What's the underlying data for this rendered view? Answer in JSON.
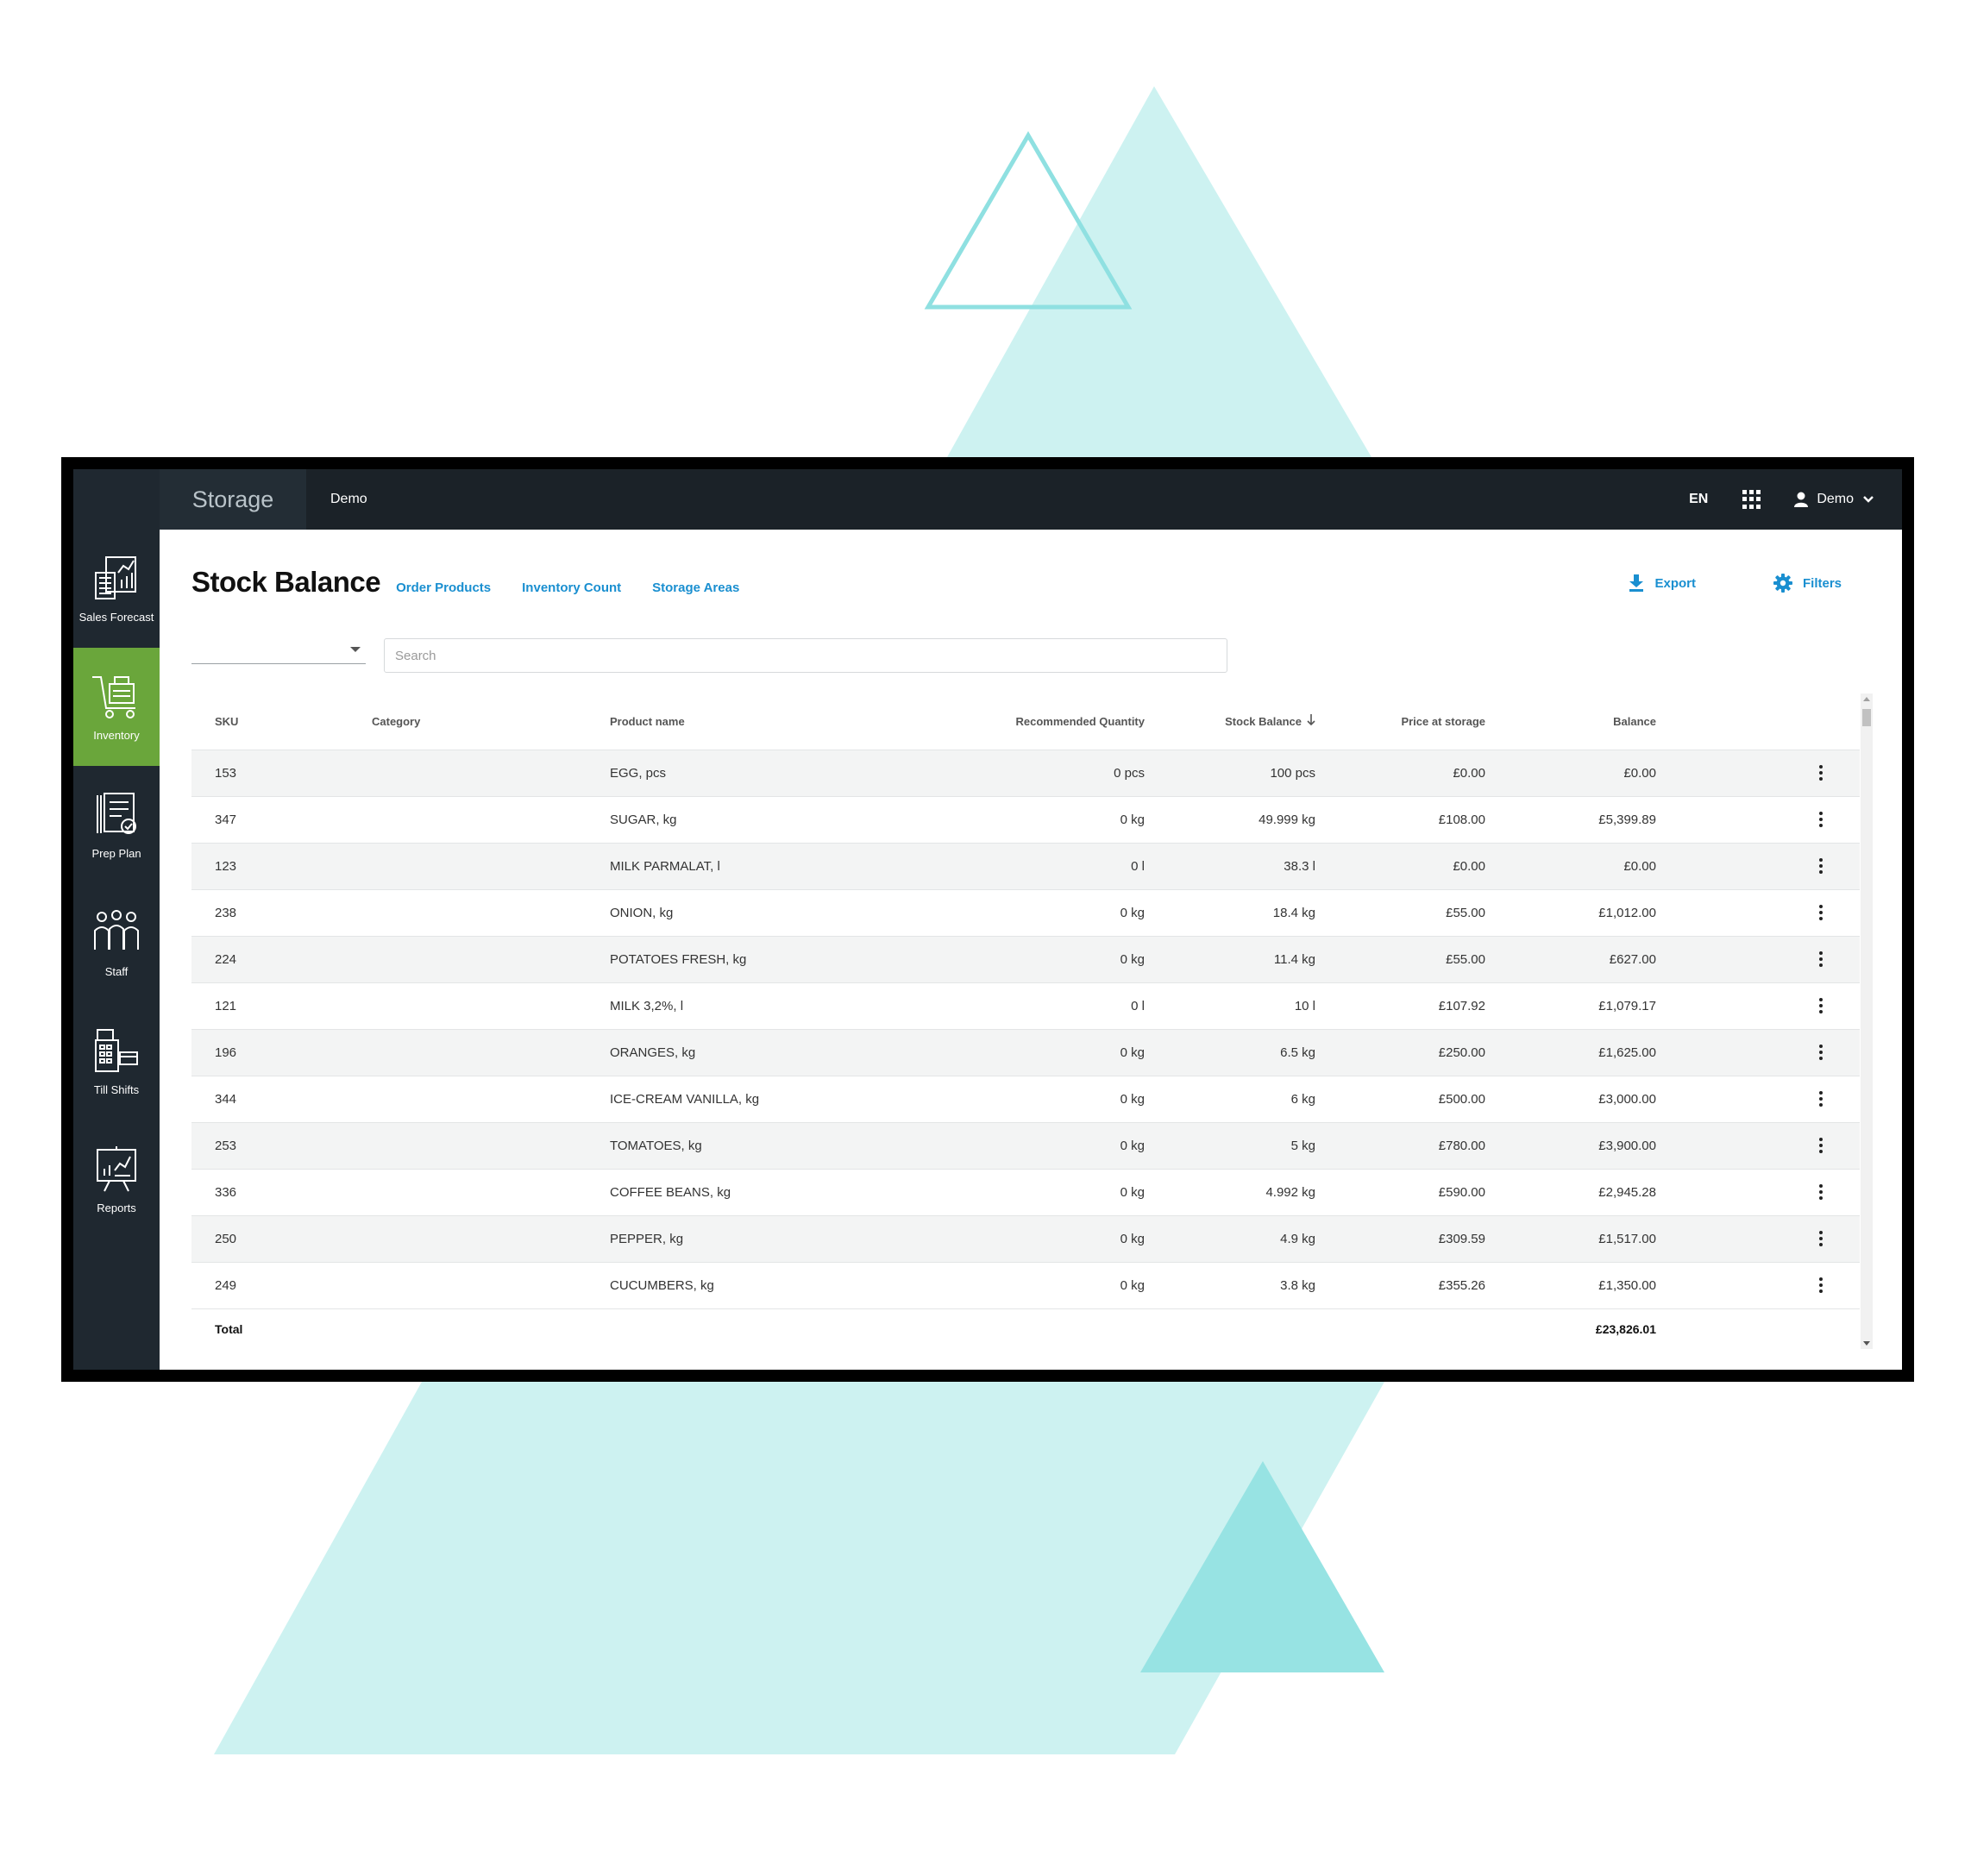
{
  "header": {
    "app_title": "Storage",
    "venue": "Demo",
    "language": "EN",
    "user": "Demo"
  },
  "sidebar": {
    "items": [
      {
        "label": "Sales Forecast",
        "icon": "sales-forecast-icon",
        "active": false
      },
      {
        "label": "Inventory",
        "icon": "inventory-cart-icon",
        "active": true
      },
      {
        "label": "Prep Plan",
        "icon": "prep-plan-icon",
        "active": false
      },
      {
        "label": "Staff",
        "icon": "staff-icon",
        "active": false
      },
      {
        "label": "Till Shifts",
        "icon": "till-icon",
        "active": false
      },
      {
        "label": "Reports",
        "icon": "reports-icon",
        "active": false
      }
    ]
  },
  "page": {
    "title": "Stock Balance",
    "links": [
      "Order Products",
      "Inventory Count",
      "Storage Areas"
    ],
    "export_label": "Export",
    "filters_label": "Filters",
    "search_placeholder": "Search",
    "select_value": ""
  },
  "table": {
    "columns": {
      "sku": "SKU",
      "category": "Category",
      "product": "Product name",
      "recommended": "Recommended Quantity",
      "stock_balance": "Stock Balance",
      "price": "Price at storage",
      "balance": "Balance"
    },
    "rows": [
      {
        "sku": "153",
        "category": "",
        "product": "EGG, pcs",
        "recommended": "0 pcs",
        "stock": "100 pcs",
        "price": "£0.00",
        "balance": "£0.00"
      },
      {
        "sku": "347",
        "category": "",
        "product": "SUGAR, kg",
        "recommended": "0 kg",
        "stock": "49.999 kg",
        "price": "£108.00",
        "balance": "£5,399.89"
      },
      {
        "sku": "123",
        "category": "",
        "product": "MILK PARMALAT, l",
        "recommended": "0 l",
        "stock": "38.3 l",
        "price": "£0.00",
        "balance": "£0.00"
      },
      {
        "sku": "238",
        "category": "",
        "product": "ONION, kg",
        "recommended": "0 kg",
        "stock": "18.4 kg",
        "price": "£55.00",
        "balance": "£1,012.00"
      },
      {
        "sku": "224",
        "category": "",
        "product": "POTATOES FRESH, kg",
        "recommended": "0 kg",
        "stock": "11.4 kg",
        "price": "£55.00",
        "balance": "£627.00"
      },
      {
        "sku": "121",
        "category": "",
        "product": "MILK 3,2%, l",
        "recommended": "0 l",
        "stock": "10 l",
        "price": "£107.92",
        "balance": "£1,079.17"
      },
      {
        "sku": "196",
        "category": "",
        "product": "ORANGES, kg",
        "recommended": "0 kg",
        "stock": "6.5 kg",
        "price": "£250.00",
        "balance": "£1,625.00"
      },
      {
        "sku": "344",
        "category": "",
        "product": "ICE-CREAM VANILLA, kg",
        "recommended": "0 kg",
        "stock": "6 kg",
        "price": "£500.00",
        "balance": "£3,000.00"
      },
      {
        "sku": "253",
        "category": "",
        "product": "TOMATOES, kg",
        "recommended": "0 kg",
        "stock": "5 kg",
        "price": "£780.00",
        "balance": "£3,900.00"
      },
      {
        "sku": "336",
        "category": "",
        "product": "COFFEE BEANS, kg",
        "recommended": "0 kg",
        "stock": "4.992 kg",
        "price": "£590.00",
        "balance": "£2,945.28"
      },
      {
        "sku": "250",
        "category": "",
        "product": "PEPPER, kg",
        "recommended": "0 kg",
        "stock": "4.9 kg",
        "price": "£309.59",
        "balance": "£1,517.00"
      },
      {
        "sku": "249",
        "category": "",
        "product": "CUCUMBERS, kg",
        "recommended": "0 kg",
        "stock": "3.8 kg",
        "price": "£355.26",
        "balance": "£1,350.00"
      }
    ],
    "total_label": "Total",
    "total_value": "£23,826.01"
  },
  "colors": {
    "accent_link": "#1a8fd0",
    "active_nav": "#6aa63b",
    "topbar": "#1b2228",
    "sidebar": "#1f2830",
    "decor_light": "#cdf2f1",
    "decor_dark": "#97e3e3"
  }
}
